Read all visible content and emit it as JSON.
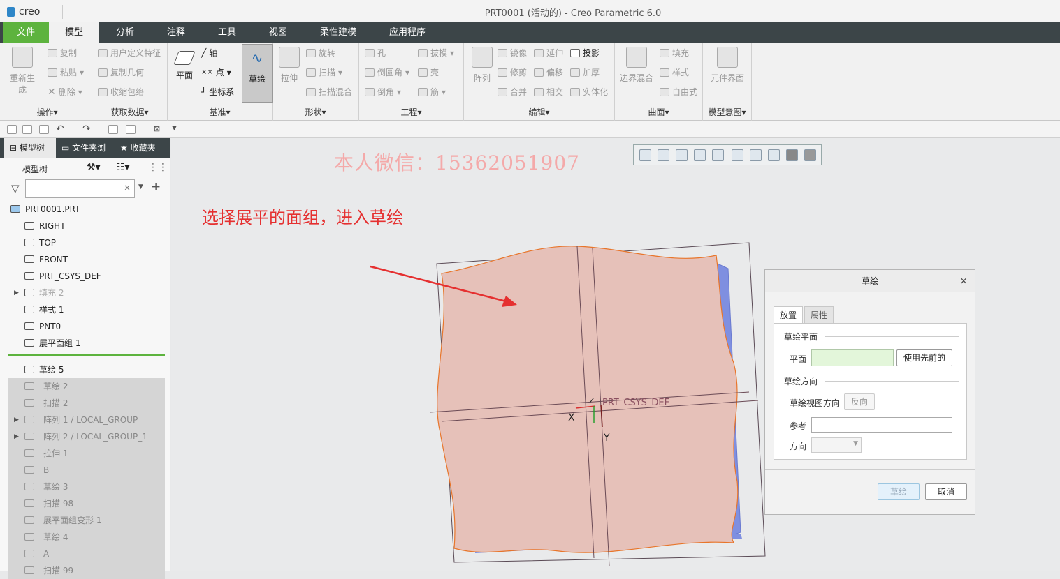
{
  "app": {
    "logo": "creo",
    "window_title": "PRT0001 (活动的) - Creo Parametric 6.0"
  },
  "menu_tabs": [
    "文件",
    "模型",
    "分析",
    "注释",
    "工具",
    "视图",
    "柔性建模",
    "应用程序"
  ],
  "ribbon": {
    "ops": {
      "regen": "重新生成",
      "copy": "复制",
      "paste": "粘贴",
      "delete": "删除",
      "label": "操作▾"
    },
    "data": {
      "udf": "用户定义特征",
      "copy_geom": "复制几何",
      "shrinkwrap": "收缩包络",
      "label": "获取数据▾"
    },
    "datum": {
      "plane": "平面",
      "axis": "轴",
      "point": "点",
      "csys": "坐标系",
      "sketch": "草绘",
      "label": "基准▾"
    },
    "shape": {
      "extrude": "拉伸",
      "revolve": "旋转",
      "sweep": "扫描",
      "swept_blend": "扫描混合",
      "label": "形状▾"
    },
    "eng": {
      "hole": "孔",
      "round": "倒圆角",
      "chamfer": "倒角",
      "draft": "拔模",
      "shell": "壳",
      "rib": "筋",
      "label": "工程▾"
    },
    "edit": {
      "pattern": "阵列",
      "mirror": "镜像",
      "extend": "延伸",
      "project": "投影",
      "trim": "修剪",
      "offset": "偏移",
      "thicken": "加厚",
      "merge": "合并",
      "intersect": "相交",
      "solidify": "实体化",
      "label": "编辑▾"
    },
    "surface": {
      "boundary": "边界混合",
      "fill": "填充",
      "style": "样式",
      "freestyle": "自由式",
      "label": "曲面▾"
    },
    "intent": {
      "component_interface": "元件界面",
      "label": "模型意图▾"
    }
  },
  "panel": {
    "tabs": [
      "模型树",
      "文件夹浏",
      "收藏夹"
    ],
    "tree_header": "模型树",
    "search_value": "",
    "tree": [
      {
        "label": "PRT0001.PRT",
        "state": "normal",
        "expand": false
      },
      {
        "label": "RIGHT",
        "state": "normal",
        "expand": false
      },
      {
        "label": "TOP",
        "state": "normal",
        "expand": false
      },
      {
        "label": "FRONT",
        "state": "normal",
        "expand": false
      },
      {
        "label": "PRT_CSYS_DEF",
        "state": "normal",
        "expand": false
      },
      {
        "label": "填充 2",
        "state": "dim",
        "expand": true
      },
      {
        "label": "样式 1",
        "state": "normal",
        "expand": false
      },
      {
        "label": "PNT0",
        "state": "normal",
        "expand": false
      },
      {
        "label": "展平面组 1",
        "state": "normal",
        "expand": false
      },
      {
        "label": "草绘 5",
        "state": "normal",
        "expand": false
      },
      {
        "label": "草绘 2",
        "state": "grey",
        "expand": false
      },
      {
        "label": "扫描 2",
        "state": "grey",
        "expand": false
      },
      {
        "label": "阵列 1 / LOCAL_GROUP",
        "state": "grey",
        "expand": true
      },
      {
        "label": "阵列 2 / LOCAL_GROUP_1",
        "state": "grey",
        "expand": true
      },
      {
        "label": "拉伸 1",
        "state": "grey",
        "expand": false
      },
      {
        "label": "B",
        "state": "grey",
        "expand": false
      },
      {
        "label": "草绘 3",
        "state": "grey",
        "expand": false
      },
      {
        "label": "扫描 98",
        "state": "grey",
        "expand": false
      },
      {
        "label": "展平面组变形 1",
        "state": "grey",
        "expand": false
      },
      {
        "label": "草绘 4",
        "state": "grey",
        "expand": false
      },
      {
        "label": "A",
        "state": "grey",
        "expand": false
      },
      {
        "label": "扫描 99",
        "state": "grey",
        "expand": false
      }
    ]
  },
  "canvas": {
    "watermark": "本人微信：15362051907",
    "callout": "选择展平的面组，进入草绘",
    "csys_label": "PRT_CSYS_DEF",
    "axis_x": "X",
    "axis_y": "Y",
    "axis_z": "Z",
    "surface_fill": "#e6c1b9",
    "surface_edge": "#e8752a",
    "arrow_color": "#e53030"
  },
  "dialog": {
    "title": "草绘",
    "tabs": [
      "放置",
      "属性"
    ],
    "section_plane": "草绘平面",
    "plane_label": "平面",
    "use_prev": "使用先前的",
    "section_orient": "草绘方向",
    "view_dir_label": "草绘视图方向",
    "flip": "反向",
    "ref_label": "参考",
    "dir_label": "方向",
    "ok": "草绘",
    "cancel": "取消"
  }
}
